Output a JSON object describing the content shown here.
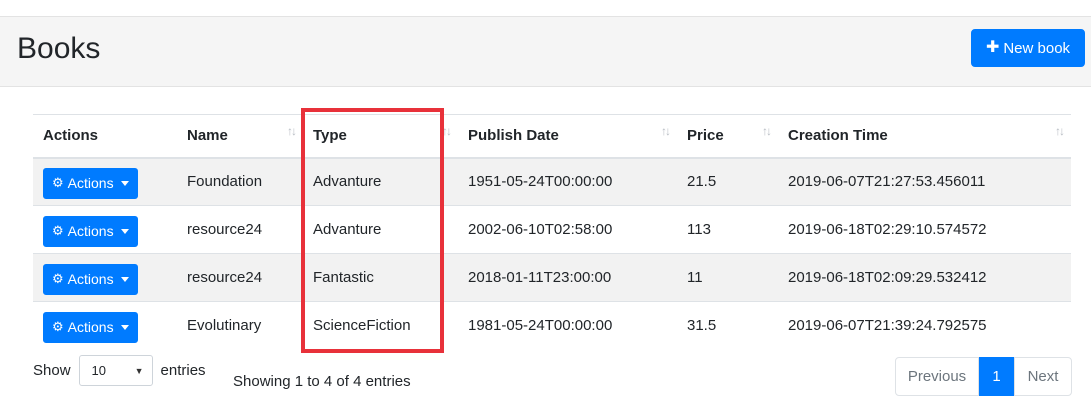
{
  "page": {
    "title": "Books",
    "new_book_label": "New book"
  },
  "table": {
    "columns": [
      "Actions",
      "Name",
      "Type",
      "Publish Date",
      "Price",
      "Creation Time"
    ],
    "rows": [
      {
        "action_label": "Actions",
        "name": "Foundation",
        "type": "Advanture",
        "publish_date": "1951-05-24T00:00:00",
        "price": "21.5",
        "creation_time": "2019-06-07T21:27:53.456011"
      },
      {
        "action_label": "Actions",
        "name": "resource24",
        "type": "Advanture",
        "publish_date": "2002-06-10T02:58:00",
        "price": "113",
        "creation_time": "2019-06-18T02:29:10.574572"
      },
      {
        "action_label": "Actions",
        "name": "resource24",
        "type": "Fantastic",
        "publish_date": "2018-01-11T23:00:00",
        "price": "11",
        "creation_time": "2019-06-18T02:09:29.532412"
      },
      {
        "action_label": "Actions",
        "name": "Evolutinary",
        "type": "ScienceFiction",
        "publish_date": "1981-05-24T00:00:00",
        "price": "31.5",
        "creation_time": "2019-06-07T21:39:24.792575"
      }
    ]
  },
  "length_menu": {
    "prefix": "Show",
    "value": "10",
    "suffix": "entries"
  },
  "info": "Showing 1 to 4 of 4 entries",
  "pagination": {
    "previous": "Previous",
    "current": "1",
    "next": "Next"
  },
  "colors": {
    "primary": "#007bff",
    "highlight": "#e8313a"
  },
  "icons": {
    "new_book": "plus-icon",
    "actions": "cog-icon",
    "sort": "sort-icon"
  }
}
